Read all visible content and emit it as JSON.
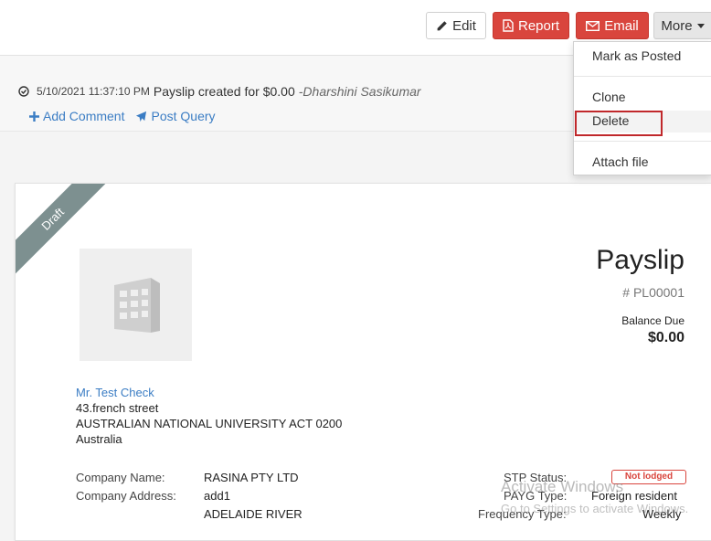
{
  "toolbar": {
    "edit_label": "Edit",
    "report_label": "Report",
    "email_label": "Email",
    "more_label": "More"
  },
  "more_menu": {
    "items": [
      {
        "label": "Mark as Posted"
      },
      {
        "label": "Clone"
      },
      {
        "label": "Delete"
      },
      {
        "label": "Attach file"
      }
    ]
  },
  "activity": {
    "timestamp": "5/10/2021 11:37:10 PM",
    "message": "Payslip created for $0.00",
    "separator": " - ",
    "user": "Dharshini Sasikumar",
    "add_comment_label": "Add Comment",
    "post_query_label": "Post Query"
  },
  "payslip": {
    "ribbon": "Draft",
    "title": "Payslip",
    "number": "# PL00001",
    "balance_label": "Balance Due",
    "balance_value": "$0.00",
    "employee_name": "Mr. Test Check",
    "address_line1": "43.french street",
    "address_line2": "AUSTRALIAN NATIONAL UNIVERSITY ACT 0200",
    "address_line3": "Australia",
    "company_name_label": "Company Name:",
    "company_name_value": "RASINA PTY LTD",
    "company_address_label": "Company Address:",
    "company_address_line1": "add1",
    "company_address_line2": "ADELAIDE RIVER",
    "stp_status_label": "STP Status:",
    "stp_status_value": "Not lodged",
    "payg_type_label": "PAYG Type:",
    "payg_type_value": "Foreign resident",
    "frequency_type_label": "Frequency Type:",
    "frequency_type_value": "Weekly"
  },
  "watermark": {
    "title": "Activate Windows",
    "subtitle": "Go to Settings to activate Windows."
  },
  "colors": {
    "danger": "#d9453d",
    "link": "#3b7dc4",
    "ribbon": "#7d9090",
    "highlight": "#c0282b"
  }
}
